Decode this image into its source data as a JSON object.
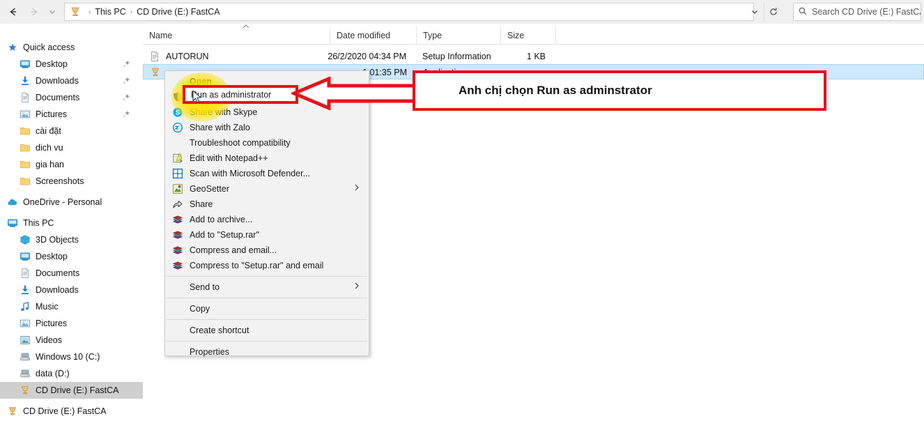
{
  "window": {
    "nav": {
      "back_icon": "arrow-left-icon",
      "forward_icon": "arrow-right-icon",
      "recent_icon": "chevron-down-icon",
      "up_icon": "arrow-up-icon"
    },
    "breadcrumb": {
      "drive_icon": "cd-drive-icon",
      "items": [
        "This PC",
        "CD Drive (E:) FastCA"
      ],
      "separator": "›",
      "dropdown_icon": "chevron-down-icon",
      "refresh_icon": "refresh-icon"
    },
    "search": {
      "icon": "search-icon",
      "placeholder": "Search CD Drive (E:) FastCA",
      "value": ""
    }
  },
  "sidebar": {
    "items": [
      {
        "label": "Quick access",
        "icon": "star-icon",
        "indent": 1,
        "pinned": false,
        "selected": false
      },
      {
        "label": "Desktop",
        "icon": "desktop-icon",
        "indent": 2,
        "pinned": true,
        "selected": false
      },
      {
        "label": "Downloads",
        "icon": "downloads-icon",
        "indent": 2,
        "pinned": true,
        "selected": false
      },
      {
        "label": "Documents",
        "icon": "documents-icon",
        "indent": 2,
        "pinned": true,
        "selected": false
      },
      {
        "label": "Pictures",
        "icon": "pictures-icon",
        "indent": 2,
        "pinned": true,
        "selected": false
      },
      {
        "label": "cài đặt",
        "icon": "folder-icon",
        "indent": 2,
        "pinned": false,
        "selected": false
      },
      {
        "label": "dich vu",
        "icon": "folder-icon",
        "indent": 2,
        "pinned": false,
        "selected": false
      },
      {
        "label": "gia han",
        "icon": "folder-icon",
        "indent": 2,
        "pinned": false,
        "selected": false
      },
      {
        "label": "Screenshots",
        "icon": "folder-icon",
        "indent": 2,
        "pinned": false,
        "selected": false
      },
      {
        "label": "OneDrive - Personal",
        "icon": "onedrive-icon",
        "indent": 1,
        "pinned": false,
        "selected": false,
        "gap_before": true
      },
      {
        "label": "This PC",
        "icon": "this-pc-icon",
        "indent": 1,
        "pinned": false,
        "selected": false,
        "gap_before": true
      },
      {
        "label": "3D Objects",
        "icon": "3d-objects-icon",
        "indent": 2,
        "pinned": false,
        "selected": false
      },
      {
        "label": "Desktop",
        "icon": "desktop-icon",
        "indent": 2,
        "pinned": false,
        "selected": false
      },
      {
        "label": "Documents",
        "icon": "documents-icon",
        "indent": 2,
        "pinned": false,
        "selected": false
      },
      {
        "label": "Downloads",
        "icon": "downloads-icon",
        "indent": 2,
        "pinned": false,
        "selected": false
      },
      {
        "label": "Music",
        "icon": "music-icon",
        "indent": 2,
        "pinned": false,
        "selected": false
      },
      {
        "label": "Pictures",
        "icon": "pictures-icon",
        "indent": 2,
        "pinned": false,
        "selected": false
      },
      {
        "label": "Videos",
        "icon": "videos-icon",
        "indent": 2,
        "pinned": false,
        "selected": false
      },
      {
        "label": "Windows 10 (C:)",
        "icon": "hard-drive-icon",
        "indent": 2,
        "pinned": false,
        "selected": false
      },
      {
        "label": "data (D:)",
        "icon": "hard-drive-icon",
        "indent": 2,
        "pinned": false,
        "selected": false
      },
      {
        "label": "CD Drive (E:) FastCA",
        "icon": "cd-drive-icon",
        "indent": 2,
        "pinned": false,
        "selected": true
      },
      {
        "label": "CD Drive (E:) FastCA",
        "icon": "cd-drive-icon",
        "indent": 1,
        "pinned": false,
        "selected": false,
        "gap_before": true
      }
    ]
  },
  "filelist": {
    "columns": [
      {
        "label": "Name",
        "sorted": true,
        "sort_icon": "caret-up-icon"
      },
      {
        "label": "Date modified",
        "sorted": false
      },
      {
        "label": "Type",
        "sorted": false
      },
      {
        "label": "Size",
        "sorted": false
      }
    ],
    "rows": [
      {
        "name": "AUTORUN",
        "icon": "setup-information-icon",
        "date_modified": "26/2/2020 04:34 PM",
        "type": "Setup Information",
        "size": "1 KB",
        "selected": false
      },
      {
        "name": "",
        "icon": "application-icon",
        "date_modified": "1 01:35 PM",
        "type": "Application",
        "size": "",
        "selected": true
      }
    ]
  },
  "context_menu": {
    "items": [
      {
        "label": "Open",
        "icon": "",
        "submenu": false,
        "bold": true,
        "separator_after": false
      },
      {
        "label": "Run as administrator",
        "icon": "shield-icon",
        "submenu": false,
        "separator_after": false
      },
      {
        "label": "Share with Skype",
        "icon": "skype-icon",
        "submenu": false,
        "separator_after": false
      },
      {
        "label": "Share with Zalo",
        "icon": "zalo-icon",
        "submenu": false,
        "separator_after": false
      },
      {
        "label": "Troubleshoot compatibility",
        "icon": "",
        "submenu": false,
        "separator_after": false
      },
      {
        "label": "Edit with Notepad++",
        "icon": "notepad-plus-icon",
        "submenu": false,
        "separator_after": false
      },
      {
        "label": "Scan with Microsoft Defender...",
        "icon": "defender-icon",
        "submenu": false,
        "separator_after": false
      },
      {
        "label": "GeoSetter",
        "icon": "geosetter-icon",
        "submenu": true,
        "separator_after": false
      },
      {
        "label": "Share",
        "icon": "share-icon",
        "submenu": false,
        "separator_after": false
      },
      {
        "label": "Add to archive...",
        "icon": "winrar-icon",
        "submenu": false,
        "separator_after": false
      },
      {
        "label": "Add to \"Setup.rar\"",
        "icon": "winrar-icon",
        "submenu": false,
        "separator_after": false
      },
      {
        "label": "Compress and email...",
        "icon": "winrar-icon",
        "submenu": false,
        "separator_after": false
      },
      {
        "label": "Compress to \"Setup.rar\" and email",
        "icon": "winrar-icon",
        "submenu": false,
        "separator_after": true
      },
      {
        "label": "Send to",
        "icon": "",
        "submenu": true,
        "separator_after": true
      },
      {
        "label": "Copy",
        "icon": "",
        "submenu": false,
        "separator_after": true
      },
      {
        "label": "Create shortcut",
        "icon": "",
        "submenu": false,
        "separator_after": true
      },
      {
        "label": "Properties",
        "icon": "",
        "submenu": false,
        "separator_after": false
      }
    ],
    "highlighted_item": "Run as administrator"
  },
  "annotation": {
    "note_text": "Anh chị chọn Run as adminstrator",
    "highlight_color": "#e8111b",
    "glow_color": "#ffe200",
    "arrow_icon": "arrow-left-icon",
    "boxed_menu_label": "Run as administrator"
  }
}
